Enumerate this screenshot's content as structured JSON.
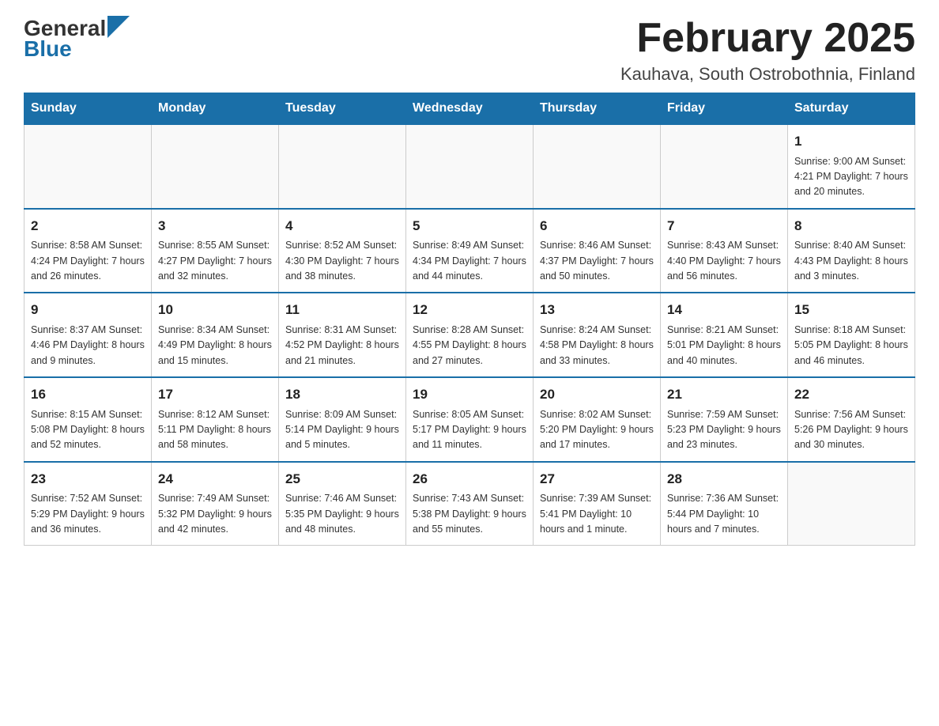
{
  "header": {
    "logo_general": "General",
    "logo_blue": "Blue",
    "month_title": "February 2025",
    "location": "Kauhava, South Ostrobothnia, Finland"
  },
  "days_of_week": [
    "Sunday",
    "Monday",
    "Tuesday",
    "Wednesday",
    "Thursday",
    "Friday",
    "Saturday"
  ],
  "weeks": [
    [
      {
        "day": "",
        "info": ""
      },
      {
        "day": "",
        "info": ""
      },
      {
        "day": "",
        "info": ""
      },
      {
        "day": "",
        "info": ""
      },
      {
        "day": "",
        "info": ""
      },
      {
        "day": "",
        "info": ""
      },
      {
        "day": "1",
        "info": "Sunrise: 9:00 AM\nSunset: 4:21 PM\nDaylight: 7 hours and 20 minutes."
      }
    ],
    [
      {
        "day": "2",
        "info": "Sunrise: 8:58 AM\nSunset: 4:24 PM\nDaylight: 7 hours and 26 minutes."
      },
      {
        "day": "3",
        "info": "Sunrise: 8:55 AM\nSunset: 4:27 PM\nDaylight: 7 hours and 32 minutes."
      },
      {
        "day": "4",
        "info": "Sunrise: 8:52 AM\nSunset: 4:30 PM\nDaylight: 7 hours and 38 minutes."
      },
      {
        "day": "5",
        "info": "Sunrise: 8:49 AM\nSunset: 4:34 PM\nDaylight: 7 hours and 44 minutes."
      },
      {
        "day": "6",
        "info": "Sunrise: 8:46 AM\nSunset: 4:37 PM\nDaylight: 7 hours and 50 minutes."
      },
      {
        "day": "7",
        "info": "Sunrise: 8:43 AM\nSunset: 4:40 PM\nDaylight: 7 hours and 56 minutes."
      },
      {
        "day": "8",
        "info": "Sunrise: 8:40 AM\nSunset: 4:43 PM\nDaylight: 8 hours and 3 minutes."
      }
    ],
    [
      {
        "day": "9",
        "info": "Sunrise: 8:37 AM\nSunset: 4:46 PM\nDaylight: 8 hours and 9 minutes."
      },
      {
        "day": "10",
        "info": "Sunrise: 8:34 AM\nSunset: 4:49 PM\nDaylight: 8 hours and 15 minutes."
      },
      {
        "day": "11",
        "info": "Sunrise: 8:31 AM\nSunset: 4:52 PM\nDaylight: 8 hours and 21 minutes."
      },
      {
        "day": "12",
        "info": "Sunrise: 8:28 AM\nSunset: 4:55 PM\nDaylight: 8 hours and 27 minutes."
      },
      {
        "day": "13",
        "info": "Sunrise: 8:24 AM\nSunset: 4:58 PM\nDaylight: 8 hours and 33 minutes."
      },
      {
        "day": "14",
        "info": "Sunrise: 8:21 AM\nSunset: 5:01 PM\nDaylight: 8 hours and 40 minutes."
      },
      {
        "day": "15",
        "info": "Sunrise: 8:18 AM\nSunset: 5:05 PM\nDaylight: 8 hours and 46 minutes."
      }
    ],
    [
      {
        "day": "16",
        "info": "Sunrise: 8:15 AM\nSunset: 5:08 PM\nDaylight: 8 hours and 52 minutes."
      },
      {
        "day": "17",
        "info": "Sunrise: 8:12 AM\nSunset: 5:11 PM\nDaylight: 8 hours and 58 minutes."
      },
      {
        "day": "18",
        "info": "Sunrise: 8:09 AM\nSunset: 5:14 PM\nDaylight: 9 hours and 5 minutes."
      },
      {
        "day": "19",
        "info": "Sunrise: 8:05 AM\nSunset: 5:17 PM\nDaylight: 9 hours and 11 minutes."
      },
      {
        "day": "20",
        "info": "Sunrise: 8:02 AM\nSunset: 5:20 PM\nDaylight: 9 hours and 17 minutes."
      },
      {
        "day": "21",
        "info": "Sunrise: 7:59 AM\nSunset: 5:23 PM\nDaylight: 9 hours and 23 minutes."
      },
      {
        "day": "22",
        "info": "Sunrise: 7:56 AM\nSunset: 5:26 PM\nDaylight: 9 hours and 30 minutes."
      }
    ],
    [
      {
        "day": "23",
        "info": "Sunrise: 7:52 AM\nSunset: 5:29 PM\nDaylight: 9 hours and 36 minutes."
      },
      {
        "day": "24",
        "info": "Sunrise: 7:49 AM\nSunset: 5:32 PM\nDaylight: 9 hours and 42 minutes."
      },
      {
        "day": "25",
        "info": "Sunrise: 7:46 AM\nSunset: 5:35 PM\nDaylight: 9 hours and 48 minutes."
      },
      {
        "day": "26",
        "info": "Sunrise: 7:43 AM\nSunset: 5:38 PM\nDaylight: 9 hours and 55 minutes."
      },
      {
        "day": "27",
        "info": "Sunrise: 7:39 AM\nSunset: 5:41 PM\nDaylight: 10 hours and 1 minute."
      },
      {
        "day": "28",
        "info": "Sunrise: 7:36 AM\nSunset: 5:44 PM\nDaylight: 10 hours and 7 minutes."
      },
      {
        "day": "",
        "info": ""
      }
    ]
  ]
}
